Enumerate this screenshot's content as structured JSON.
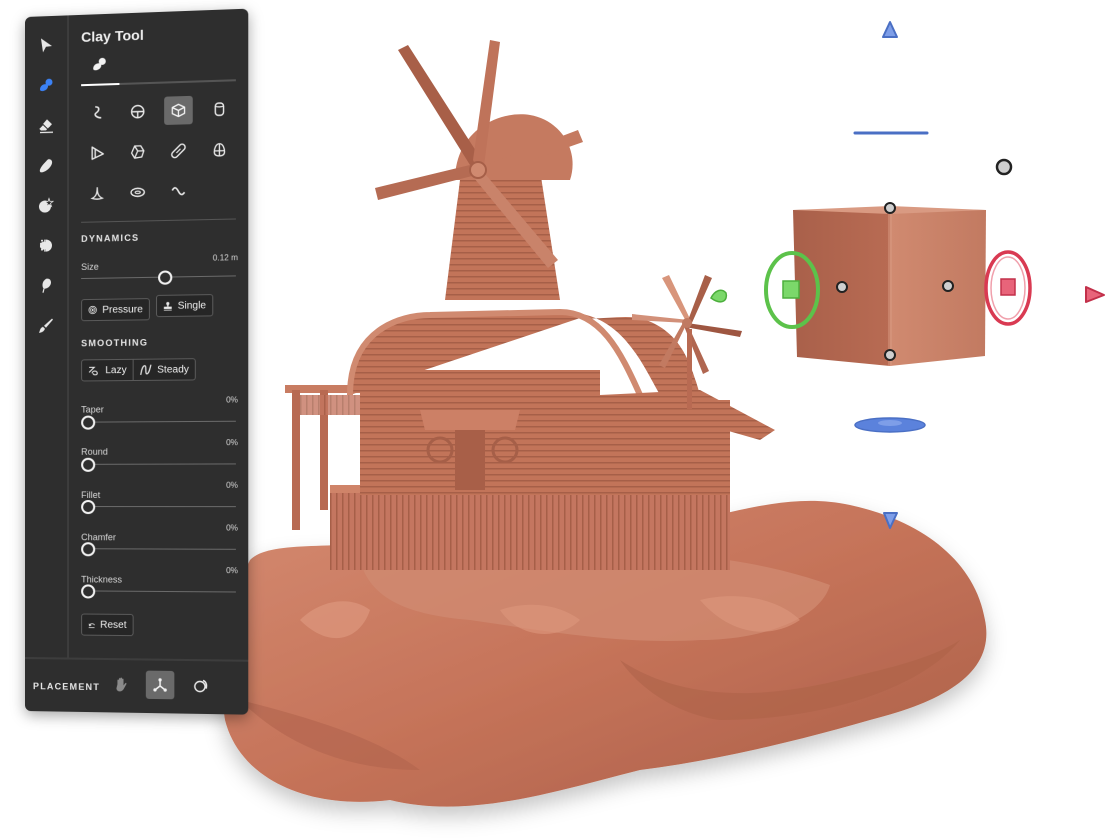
{
  "panel": {
    "title": "Clay Tool",
    "tools": [
      {
        "name": "select",
        "icon": "pointer-arrow-icon",
        "active": false
      },
      {
        "name": "clay",
        "icon": "clay-brush-icon",
        "active": true
      },
      {
        "name": "erase",
        "icon": "eraser-icon",
        "active": false
      },
      {
        "name": "smooth",
        "icon": "smooth-stone-icon",
        "active": false
      },
      {
        "name": "effects",
        "icon": "effects-burst-icon",
        "active": false
      },
      {
        "name": "symmetry",
        "icon": "symmetry-gear-icon",
        "active": false
      },
      {
        "name": "paint-fill",
        "icon": "balloon-icon",
        "active": false
      },
      {
        "name": "paint",
        "icon": "paintbrush-icon",
        "active": false
      }
    ],
    "tab": {
      "icon": "clay-brush-icon",
      "active": true
    },
    "primitives": [
      {
        "name": "curve",
        "icon": "curve-primitive-icon",
        "active": false
      },
      {
        "name": "sphere",
        "icon": "sphere-primitive-icon",
        "active": false
      },
      {
        "name": "cube",
        "icon": "cube-primitive-icon",
        "active": true
      },
      {
        "name": "cylinder",
        "icon": "cylinder-primitive-icon",
        "active": false
      },
      {
        "name": "cone-half",
        "icon": "wedge-primitive-icon",
        "active": false
      },
      {
        "name": "geosphere",
        "icon": "geosphere-primitive-icon",
        "active": false
      },
      {
        "name": "capsule",
        "icon": "capsule-primitive-icon",
        "active": false
      },
      {
        "name": "egg",
        "icon": "egg-primitive-icon",
        "active": false
      },
      {
        "name": "spike",
        "icon": "spike-primitive-icon",
        "active": false
      },
      {
        "name": "torus",
        "icon": "torus-primitive-icon",
        "active": false
      },
      {
        "name": "wave",
        "icon": "wave-primitive-icon",
        "active": false
      }
    ],
    "dynamics": {
      "label": "DYNAMICS",
      "size": {
        "label": "Size",
        "value_text": "0.12 m",
        "fraction": 0.55
      },
      "pressure_label": "Pressure",
      "single_label": "Single"
    },
    "smoothing": {
      "label": "SMOOTHING",
      "lazy_label": "Lazy",
      "steady_label": "Steady",
      "sliders": [
        {
          "label": "Taper",
          "value_text": "0%",
          "fraction": 0
        },
        {
          "label": "Round",
          "value_text": "0%",
          "fraction": 0
        },
        {
          "label": "Fillet",
          "value_text": "0%",
          "fraction": 0
        },
        {
          "label": "Chamfer",
          "value_text": "0%",
          "fraction": 0
        },
        {
          "label": "Thickness",
          "value_text": "0%",
          "fraction": 0
        }
      ]
    },
    "reset_label": "Reset",
    "placement": {
      "label": "PLACEMENT",
      "options": [
        {
          "name": "hand",
          "icon": "hand-icon",
          "active": false
        },
        {
          "name": "axis",
          "icon": "axis-tripod-icon",
          "active": true
        },
        {
          "name": "surface",
          "icon": "surface-snap-icon",
          "active": false
        }
      ]
    }
  },
  "gizmo": {
    "colors": {
      "x": "#d93a52",
      "y": "#4caf3c",
      "z": "#4a6fc4",
      "cube": "#c07a62"
    }
  },
  "model": {
    "color": "#c9775f"
  }
}
